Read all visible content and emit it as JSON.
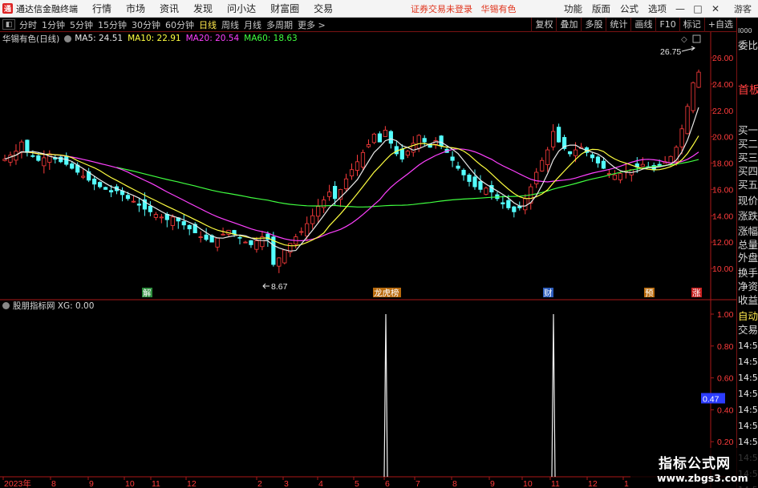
{
  "app": {
    "title": "通达信金融终端",
    "logo_mark": "通"
  },
  "menu": [
    "行情",
    "市场",
    "资讯",
    "发现",
    "问小达",
    "财富圈",
    "交易"
  ],
  "notice": {
    "login": "证券交易未登录",
    "stock": "华锡有色"
  },
  "menu_right": [
    "功能",
    "版面",
    "公式",
    "选项"
  ],
  "window_buttons": [
    "—",
    "□",
    "✕"
  ],
  "guest": "游客",
  "periods": [
    "分时",
    "1分钟",
    "5分钟",
    "15分钟",
    "30分钟",
    "60分钟",
    "日线",
    "周线",
    "月线",
    "多周期",
    "更多 >"
  ],
  "active_period": "日线",
  "tools": [
    "复权",
    "叠加",
    "多股",
    "统计",
    "画线",
    "F10",
    "标记",
    "+自选"
  ],
  "legend": {
    "name": "华锡有色(日线)",
    "ma5": "MA5: 24.51",
    "ma10": "MA10: 22.91",
    "ma20": "MA20: 20.54",
    "ma60": "MA60: 18.63"
  },
  "colors": {
    "up": "#ff3c3c",
    "down": "#54ffff",
    "ma5": "#e8e8e8",
    "ma10": "#ffff40",
    "ma20": "#ff40ff",
    "ma60": "#40ff40",
    "axis_red": "#aa1818",
    "highlight": "#2c3cff"
  },
  "annotations": {
    "high": "26.75",
    "low": "8.67",
    "markers": [
      "解",
      "龙虎榜",
      "财",
      "预",
      "涨"
    ]
  },
  "price_axis": [
    "26.00",
    "24.00",
    "22.00",
    "20.00",
    "18.00",
    "16.00",
    "14.00",
    "12.00",
    "10.00"
  ],
  "indicator": {
    "name": "股朋指标网 XG: 0.00",
    "axis": [
      "1.00",
      "0.80",
      "0.60",
      "0.47",
      "0.40",
      "0.20"
    ],
    "cursor_value": "0.47"
  },
  "x_axis": [
    "2023年",
    "8",
    "9",
    "10",
    "11",
    "12",
    "2",
    "3",
    "4",
    "5",
    "6",
    "7",
    "8",
    "9",
    "10",
    "11",
    "12",
    "1"
  ],
  "right_panel": {
    "items": [
      "委比",
      "首板",
      "买一",
      "买二",
      "买三",
      "买四",
      "买五",
      "现价",
      "涨跌",
      "涨幅",
      "总量",
      "外盘",
      "换手",
      "净资",
      "收益",
      "自动",
      "交易"
    ],
    "times": [
      "14:56",
      "14:56",
      "14:56",
      "14:56",
      "14:56",
      "14:56",
      "14:56",
      "14:56",
      "14:56",
      "14:56"
    ],
    "marker": "I000"
  },
  "watermark": {
    "title": "指标公式网",
    "url": "www.zbgs3.com"
  },
  "chart_data": {
    "type": "candlestick",
    "stock": "华锡有色",
    "period": "日线",
    "y_axis": {
      "min": 8,
      "max": 27
    },
    "closes": [
      18.3,
      18.6,
      18.9,
      19.6,
      18.8,
      18.5,
      18.2,
      18.4,
      18.7,
      18.3,
      18.1,
      17.9,
      17.6,
      17.3,
      17.0,
      16.7,
      16.4,
      16.2,
      16.0,
      15.8,
      15.9,
      15.6,
      15.3,
      15.1,
      14.8,
      14.5,
      14.3,
      14.1,
      13.9,
      13.7,
      13.9,
      13.6,
      13.3,
      13.0,
      12.7,
      12.4,
      12.2,
      12.0,
      12.3,
      12.6,
      12.9,
      12.6,
      12.3,
      12.0,
      11.8,
      12.1,
      12.4,
      12.2,
      10.3,
      10.8,
      11.4,
      11.9,
      12.4,
      12.8,
      13.4,
      14.0,
      14.7,
      15.2,
      15.8,
      15.3,
      16.0,
      16.8,
      17.5,
      18.1,
      18.8,
      19.4,
      20.2,
      19.6,
      20.5,
      19.5,
      18.7,
      18.3,
      18.9,
      19.5,
      20.1,
      19.6,
      19.2,
      19.7,
      19.3,
      18.8,
      18.2,
      17.6,
      17.1,
      16.6,
      16.2,
      16.0,
      16.1,
      15.8,
      15.3,
      14.9,
      14.6,
      14.3,
      14.6,
      15.3,
      16.2,
      17.3,
      18.2,
      19.0,
      20.4,
      19.6,
      19.1,
      18.7,
      19.0,
      19.2,
      18.8,
      18.4,
      18.0,
      17.6,
      17.2,
      17.1,
      17.2,
      17.4,
      17.5,
      17.7,
      17.9,
      17.7,
      17.5,
      17.8,
      18.1,
      18.5,
      19.2,
      20.6,
      22.3,
      24.1,
      24.9
    ]
  }
}
